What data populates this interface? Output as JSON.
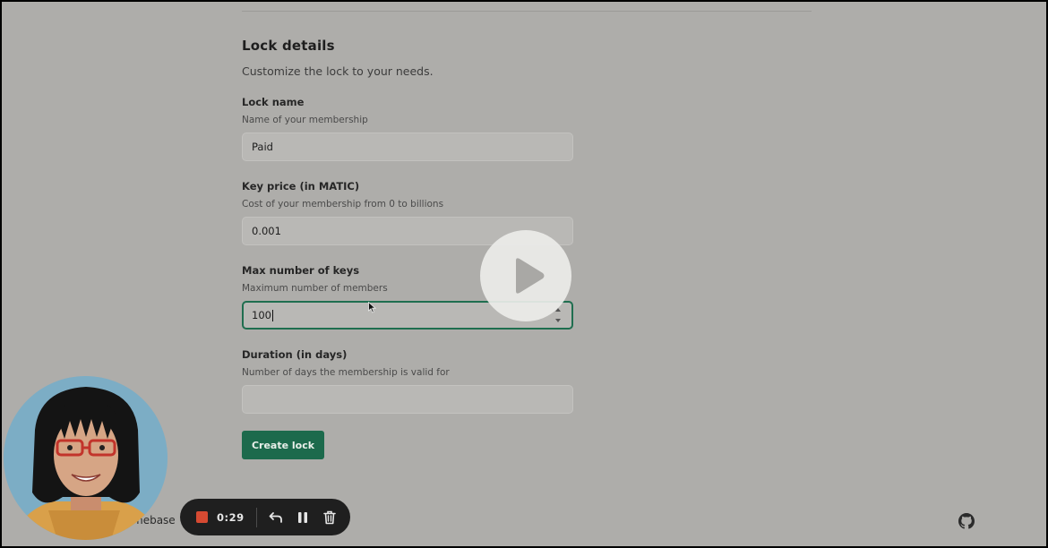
{
  "form": {
    "title": "Lock details",
    "subtitle": "Customize the lock to your needs.",
    "fields": [
      {
        "label": "Lock name",
        "help": "Name of your membership",
        "value": "Paid",
        "placeholder": ""
      },
      {
        "label": "Key price (in MATIC)",
        "help": "Cost of your membership from 0 to billions",
        "value": "0.001",
        "placeholder": ""
      },
      {
        "label": "Max number of keys",
        "help": "Maximum number of members",
        "value": "100",
        "placeholder": ""
      },
      {
        "label": "Duration (in days)",
        "help": "Number of days the membership is valid for",
        "value": "",
        "placeholder": ""
      }
    ],
    "submit_label": "Create lock"
  },
  "footer": {
    "partial_text": "mebase"
  },
  "recorder": {
    "elapsed": "0:29"
  },
  "video": {
    "state": "paused",
    "play_icon": "play-icon"
  },
  "colors": {
    "accent": "#1c6a4c",
    "record": "#d64a32",
    "background": "#aeadaa"
  },
  "icons": [
    "play-icon",
    "mouse-cursor-icon",
    "stop-record-icon",
    "undo-icon",
    "pause-icon",
    "trash-icon",
    "github-icon"
  ]
}
